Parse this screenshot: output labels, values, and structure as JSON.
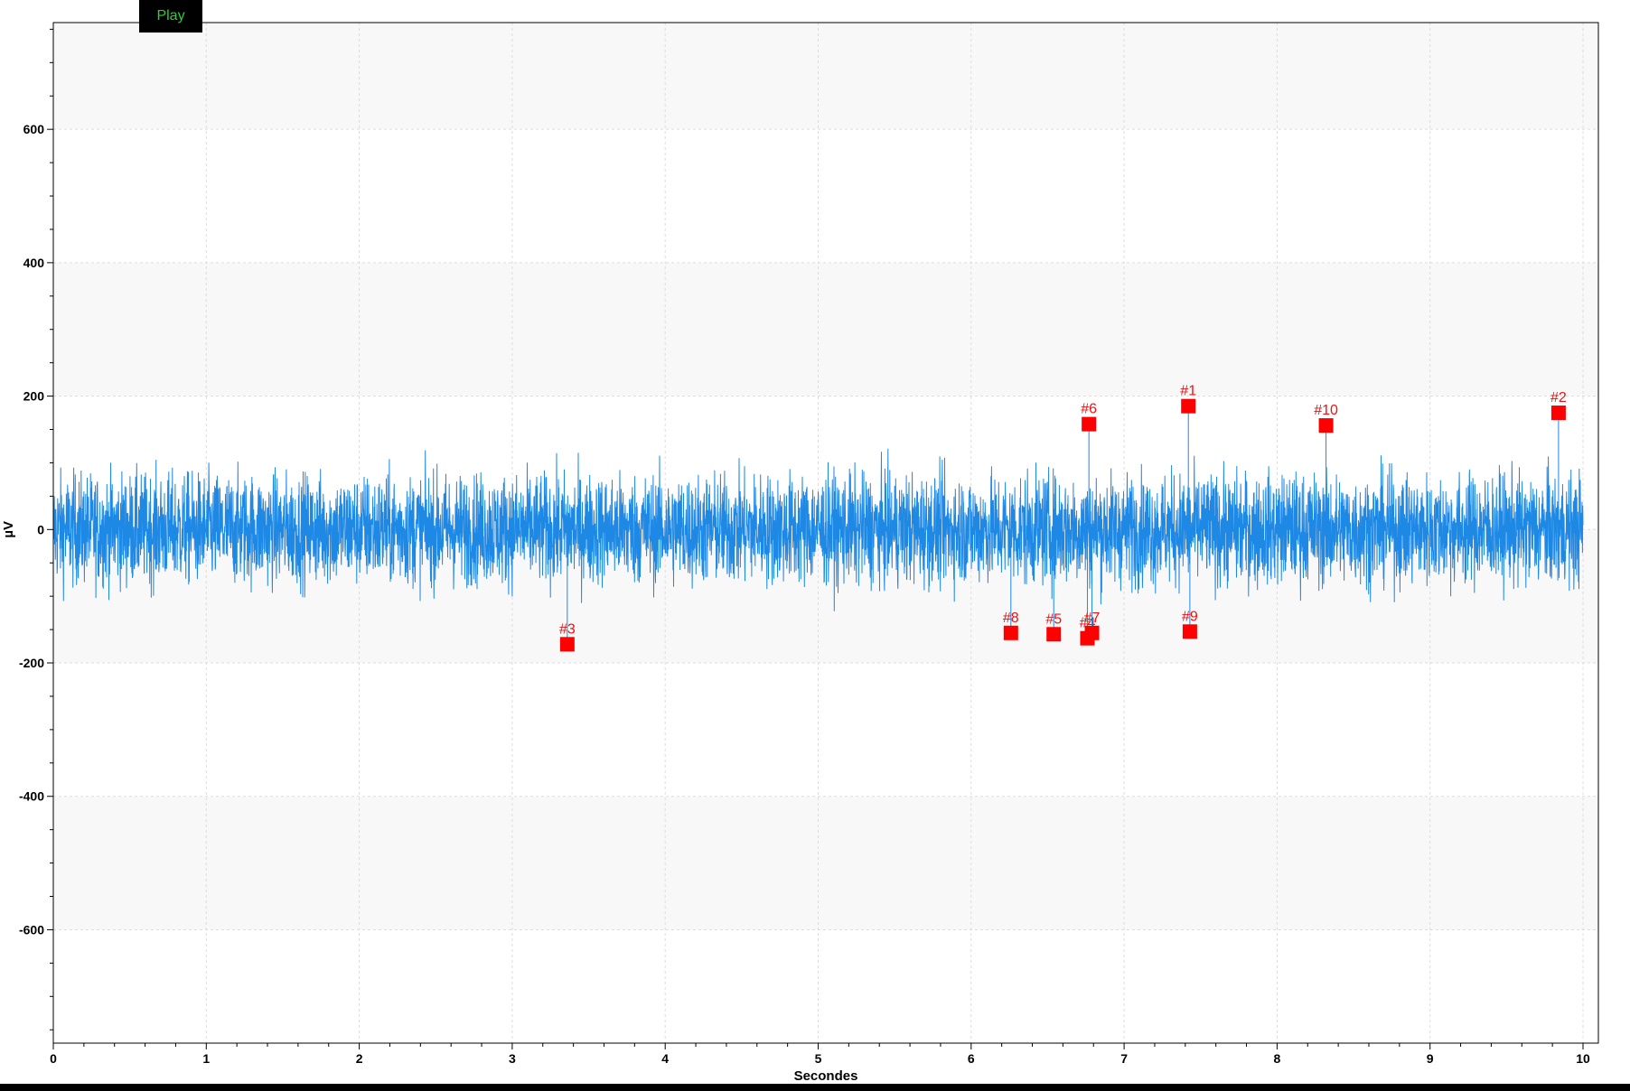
{
  "toolbar": {
    "play_label": "Play"
  },
  "colors": {
    "signal": "#1e88e5",
    "marker": "#ff0000",
    "marker_text": "#ee1111",
    "band": "#f8f8f8",
    "grid": "#dddddd",
    "play_text": "#33cc33"
  },
  "chart_data": {
    "type": "line",
    "xlabel": "Secondes",
    "ylabel": "µV",
    "xlim": [
      0,
      10
    ],
    "ylim": [
      -770,
      760
    ],
    "x_ticks": [
      0,
      1,
      2,
      3,
      4,
      5,
      6,
      7,
      8,
      9,
      10
    ],
    "y_ticks": [
      -600,
      -400,
      -200,
      0,
      200,
      400,
      600
    ],
    "grid": true,
    "series": [
      {
        "style": "dense noise trace",
        "x_range": [
          0,
          10
        ],
        "baseline": 0,
        "typical_amplitude": 75,
        "peak_amplitude": 160
      }
    ],
    "markers": [
      {
        "label": "#1",
        "x": 7.42,
        "y": 185
      },
      {
        "label": "#2",
        "x": 9.84,
        "y": 175
      },
      {
        "label": "#3",
        "x": 3.36,
        "y": -172
      },
      {
        "label": "#4",
        "x": 6.76,
        "y": -163
      },
      {
        "label": "#5",
        "x": 6.54,
        "y": -157
      },
      {
        "label": "#6",
        "x": 6.77,
        "y": 158
      },
      {
        "label": "#7",
        "x": 6.79,
        "y": -155
      },
      {
        "label": "#8",
        "x": 6.26,
        "y": -155
      },
      {
        "label": "#9",
        "x": 7.43,
        "y": -153
      },
      {
        "label": "#10",
        "x": 8.32,
        "y": 156
      }
    ]
  }
}
